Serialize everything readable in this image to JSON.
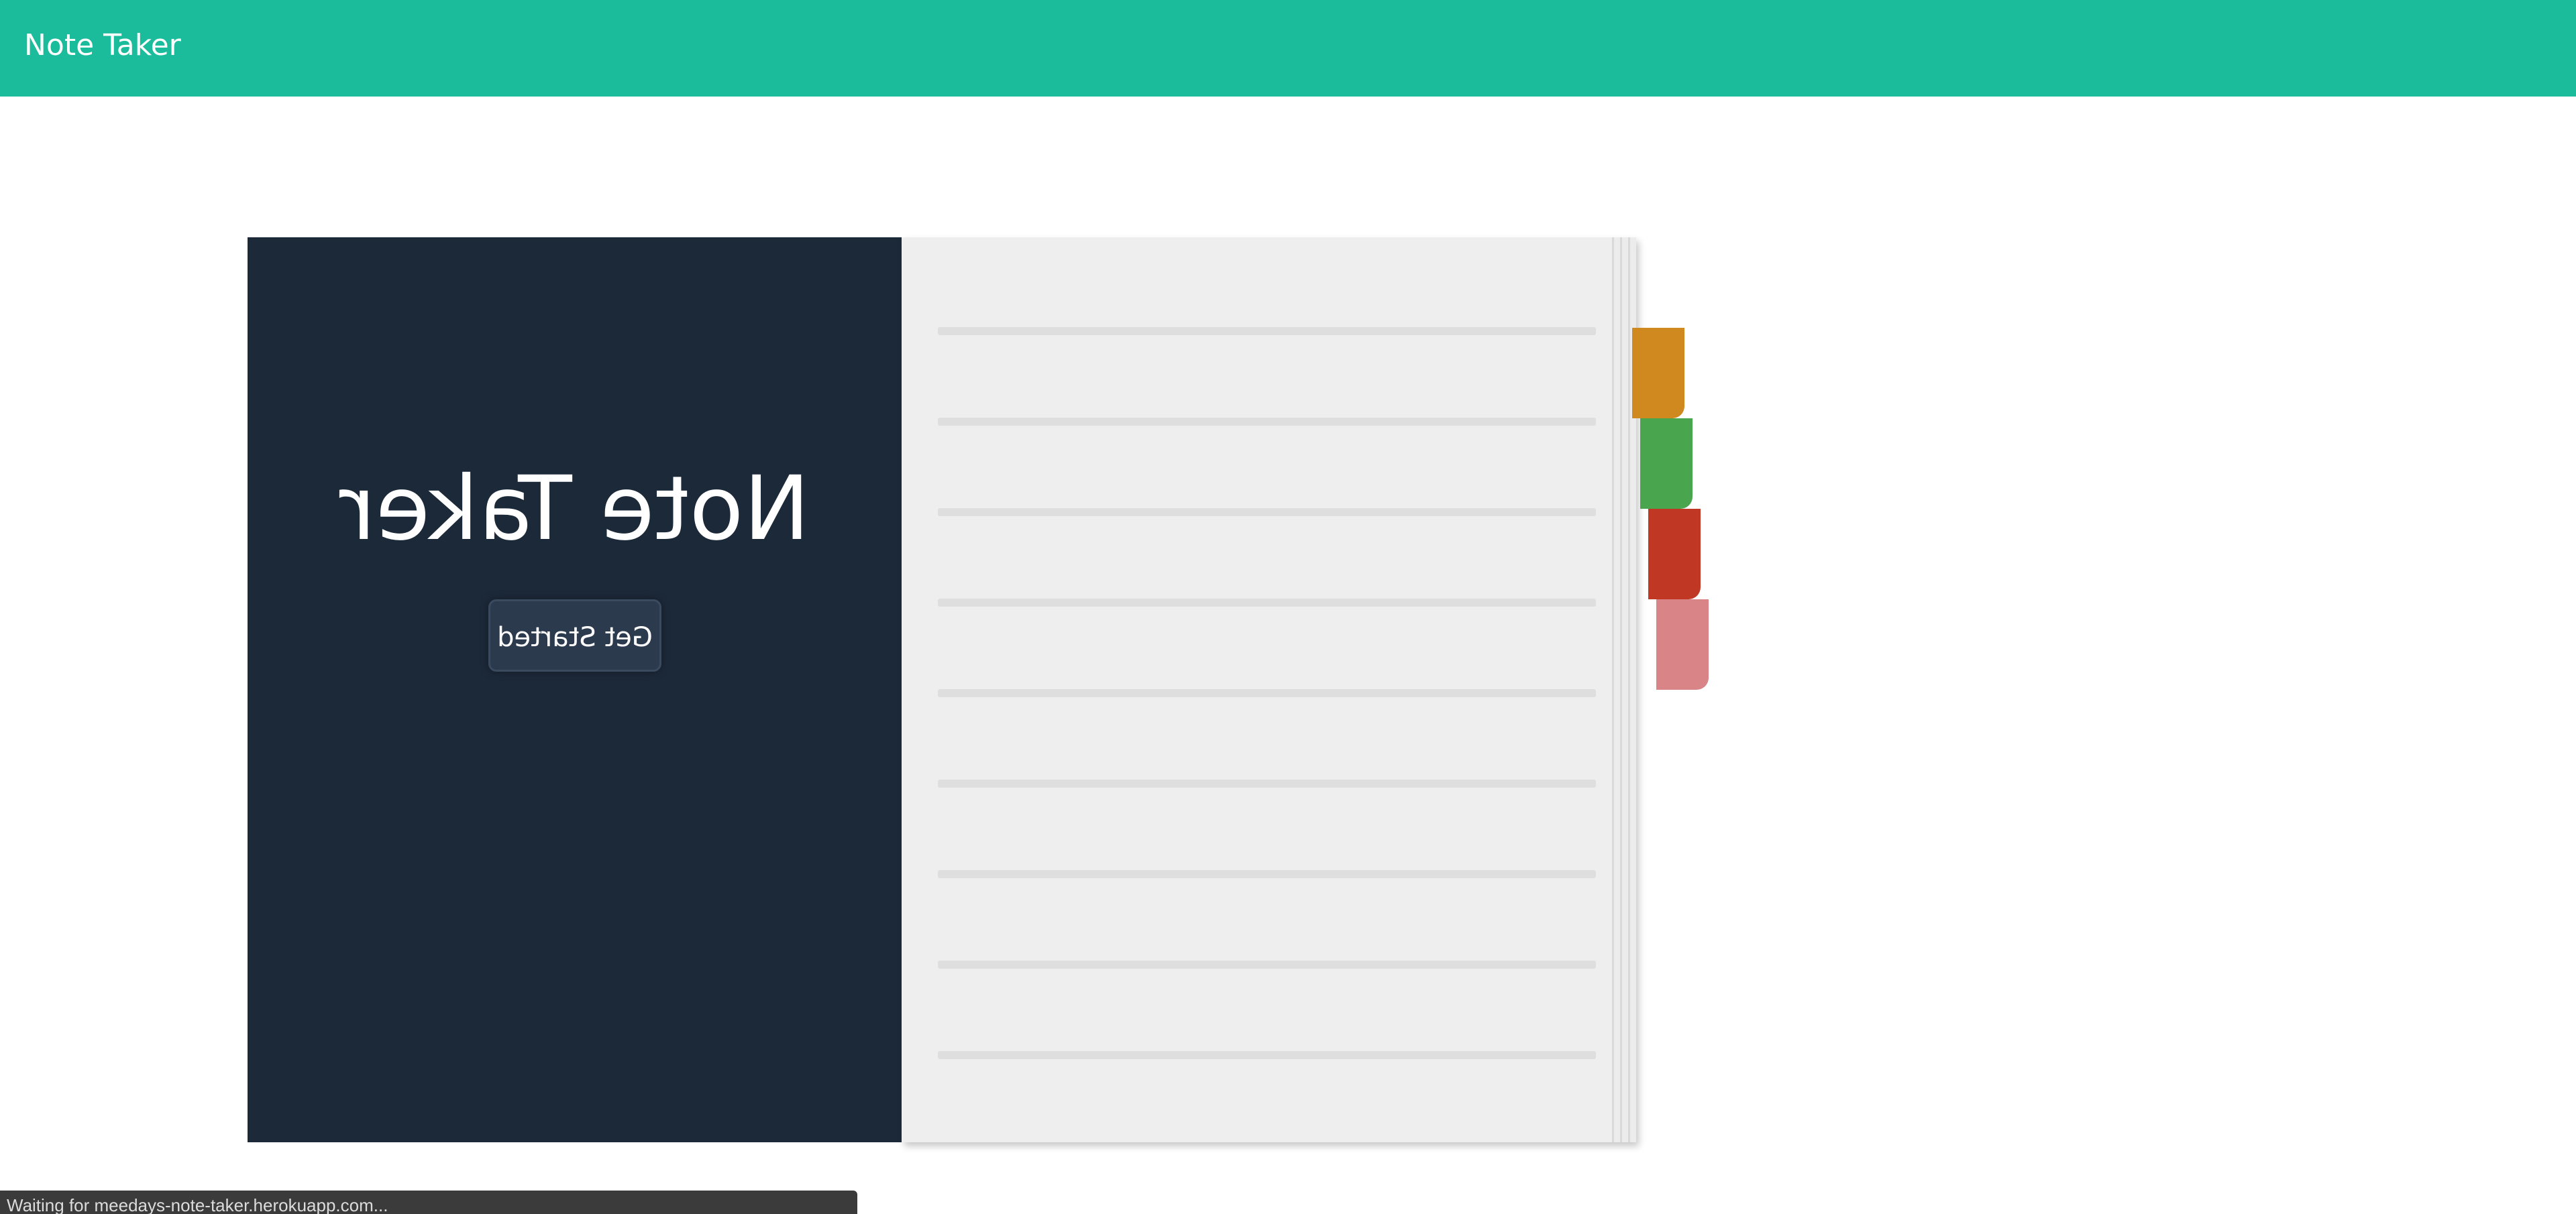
{
  "navbar": {
    "brand": "Note Taker",
    "color": "#1abc9c"
  },
  "cover": {
    "title": "Note Taker",
    "button_label": "Get Started",
    "color": "#1c2939"
  },
  "tabs": [
    {
      "name": "orange-tab",
      "color": "#cf891e"
    },
    {
      "name": "green-tab",
      "color": "#4aa64e"
    },
    {
      "name": "red-tab",
      "color": "#c03723"
    },
    {
      "name": "pink-tab",
      "color": "#d98487"
    }
  ],
  "status_bar": {
    "text": "Waiting for meedays-note-taker.herokuapp.com..."
  }
}
